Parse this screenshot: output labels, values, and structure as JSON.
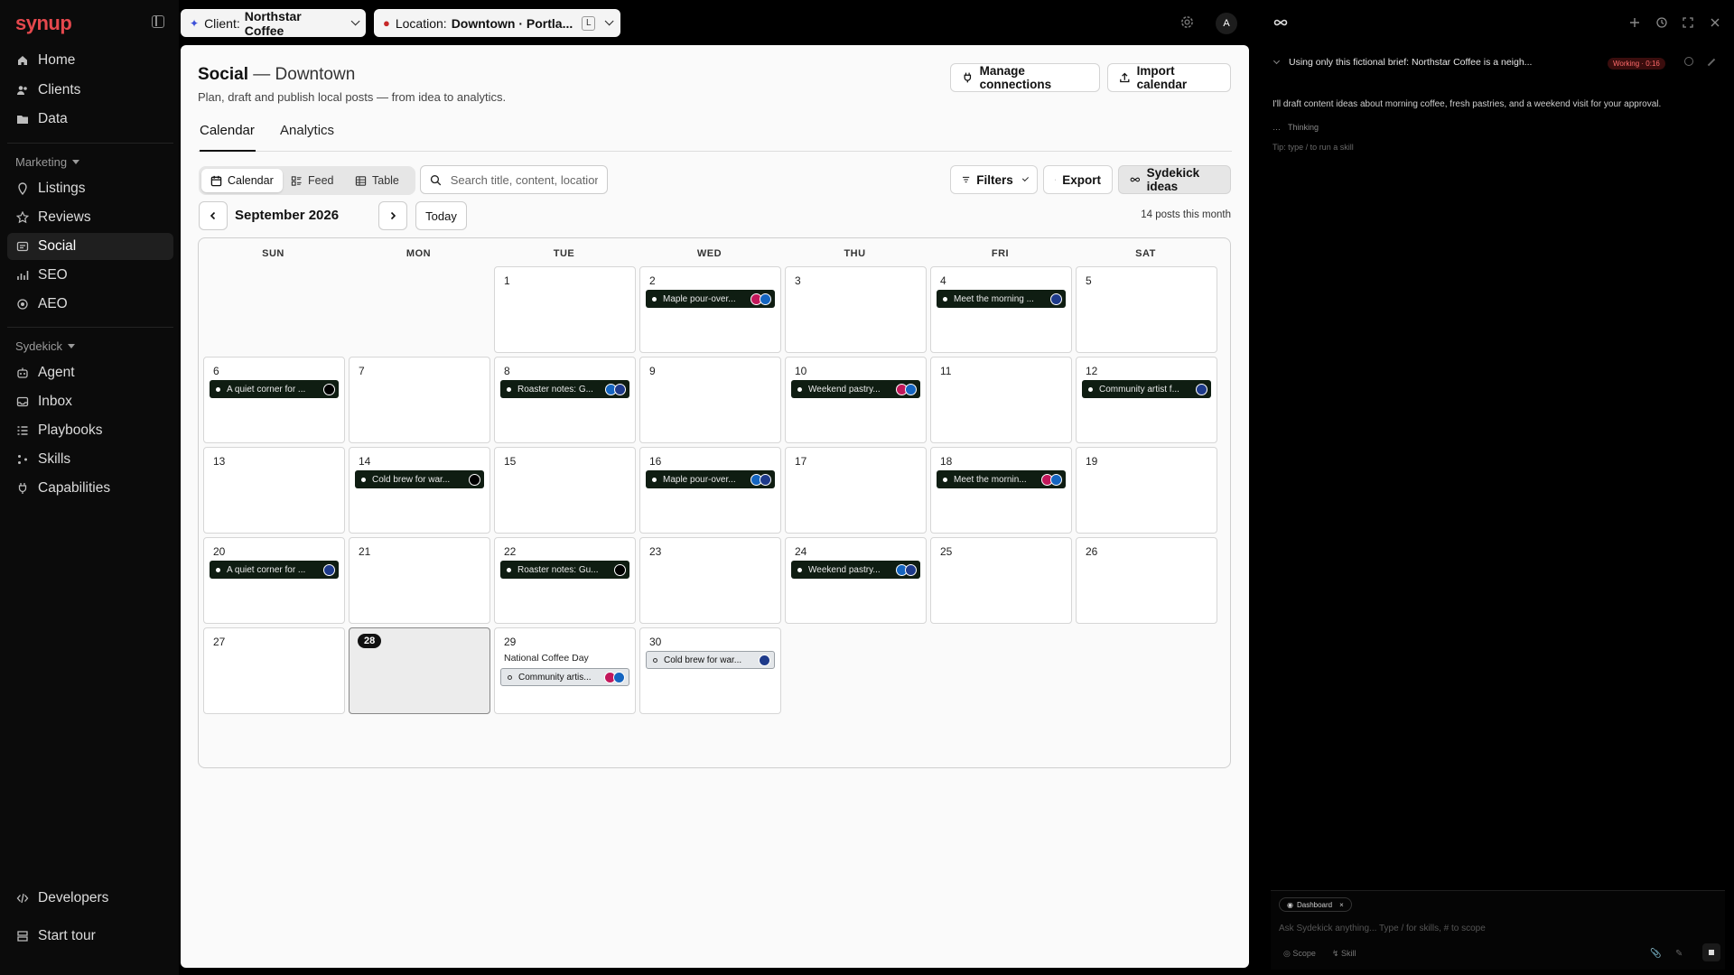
{
  "brand": {
    "logo": "synup"
  },
  "sidebar": {
    "main_items": [
      {
        "label": "Home",
        "icon": "home-icon"
      },
      {
        "label": "Clients",
        "icon": "users-icon"
      },
      {
        "label": "Data",
        "icon": "folder-icon"
      }
    ],
    "marketing_label": "Marketing",
    "marketing_items": [
      {
        "label": "Listings",
        "icon": "map-pin-icon"
      },
      {
        "label": "Reviews",
        "icon": "star-icon"
      },
      {
        "label": "Social",
        "icon": "social-icon",
        "active": true
      },
      {
        "label": "SEO",
        "icon": "chart-icon"
      },
      {
        "label": "AEO",
        "icon": "sparkle-icon"
      }
    ],
    "sydekick_label": "Sydekick",
    "sydekick_items": [
      {
        "label": "Agent",
        "icon": "bot-icon"
      },
      {
        "label": "Inbox",
        "icon": "inbox-icon"
      },
      {
        "label": "Playbooks",
        "icon": "list-icon"
      },
      {
        "label": "Skills",
        "icon": "skills-icon"
      },
      {
        "label": "Capabilities",
        "icon": "plug-icon"
      }
    ],
    "bottom_items": [
      {
        "label": "Developers",
        "icon": "code-icon"
      },
      {
        "label": "Start tour",
        "icon": "tour-icon"
      }
    ]
  },
  "topbar": {
    "client_label": "Client:",
    "client_value": "Northstar Coffee",
    "location_label": "Location:",
    "location_value": "Downtown · Portla...",
    "location_key": "L",
    "avatar": "A"
  },
  "page": {
    "title": "Social",
    "title_suffix": "— Downtown",
    "subtitle": "Plan, draft and publish local posts — from idea to analytics.",
    "manage_connections": "Manage connections",
    "import_calendar": "Import calendar",
    "tabs": [
      "Calendar",
      "Analytics"
    ],
    "views": [
      "Calendar",
      "Feed",
      "Table"
    ],
    "search_placeholder": "Search title, content, location",
    "filters": "Filters",
    "export": "Export",
    "ideas": "Sydekick ideas",
    "month": "September 2026",
    "today": "Today",
    "post_count": "14 posts this month"
  },
  "calendar": {
    "weekdays": [
      "SUN",
      "MON",
      "TUE",
      "WED",
      "THU",
      "FRI",
      "SAT"
    ],
    "weeks": [
      [
        {
          "d": ""
        },
        {
          "d": ""
        },
        {
          "d": "1"
        },
        {
          "d": "2",
          "posts": [
            {
              "t": "Maple pour-over...",
              "n": [
                "ig",
                "fb"
              ]
            }
          ]
        },
        {
          "d": "3"
        },
        {
          "d": "4",
          "posts": [
            {
              "t": "Meet the morning ...",
              "n": [
                "gb"
              ]
            }
          ]
        },
        {
          "d": "5"
        }
      ],
      [
        {
          "d": "6",
          "posts": [
            {
              "t": "A quiet corner for ...",
              "n": [
                "x"
              ]
            }
          ]
        },
        {
          "d": "7"
        },
        {
          "d": "8",
          "posts": [
            {
              "t": "Roaster notes: G...",
              "n": [
                "fb",
                "gb"
              ]
            }
          ]
        },
        {
          "d": "9"
        },
        {
          "d": "10",
          "posts": [
            {
              "t": "Weekend pastry...",
              "n": [
                "ig",
                "fb"
              ]
            }
          ]
        },
        {
          "d": "11"
        },
        {
          "d": "12",
          "posts": [
            {
              "t": "Community artist f...",
              "n": [
                "gb"
              ]
            }
          ]
        }
      ],
      [
        {
          "d": "13"
        },
        {
          "d": "14",
          "posts": [
            {
              "t": "Cold brew for war...",
              "n": [
                "x"
              ]
            }
          ]
        },
        {
          "d": "15"
        },
        {
          "d": "16",
          "posts": [
            {
              "t": "Maple pour-over...",
              "n": [
                "fb",
                "gb"
              ]
            }
          ]
        },
        {
          "d": "17"
        },
        {
          "d": "18",
          "posts": [
            {
              "t": "Meet the mornin...",
              "n": [
                "ig",
                "fb"
              ]
            }
          ]
        },
        {
          "d": "19"
        }
      ],
      [
        {
          "d": "20",
          "posts": [
            {
              "t": "A quiet corner for ...",
              "n": [
                "gb"
              ]
            }
          ]
        },
        {
          "d": "21"
        },
        {
          "d": "22",
          "posts": [
            {
              "t": "Roaster notes: Gu...",
              "n": [
                "x"
              ]
            }
          ]
        },
        {
          "d": "23"
        },
        {
          "d": "24",
          "posts": [
            {
              "t": "Weekend pastry...",
              "n": [
                "fb",
                "gb"
              ]
            }
          ]
        },
        {
          "d": "25"
        },
        {
          "d": "26"
        }
      ],
      [
        {
          "d": "27"
        },
        {
          "d": "28",
          "today": true
        },
        {
          "d": "29",
          "holiday": "National Coffee Day",
          "posts": [
            {
              "t": "Community artis...",
              "n": [
                "ig",
                "fb"
              ],
              "draft": true
            }
          ]
        },
        {
          "d": "30",
          "posts": [
            {
              "t": "Cold brew for war...",
              "n": [
                "gb"
              ],
              "draft": true
            }
          ]
        }
      ]
    ]
  },
  "assistant": {
    "thread_title": "Using only this fictional brief: Northstar Coffee is a neigh...",
    "status": "Working · 0:16",
    "message": "I'll draft content ideas about morning coffee, fresh pastries, and a weekend visit for your approval.",
    "thinking": "Thinking",
    "tip": "Tip: type / to run a skill",
    "chip": "Dashboard",
    "placeholder": "Ask Sydekick anything... Type / for skills, # to scope",
    "scope": "Scope",
    "skill": "Skill"
  },
  "colors": {
    "brand": "#e5484d",
    "post_bg": "#0f1d12",
    "instagram": "#c2185b",
    "facebook": "#1565c0"
  }
}
